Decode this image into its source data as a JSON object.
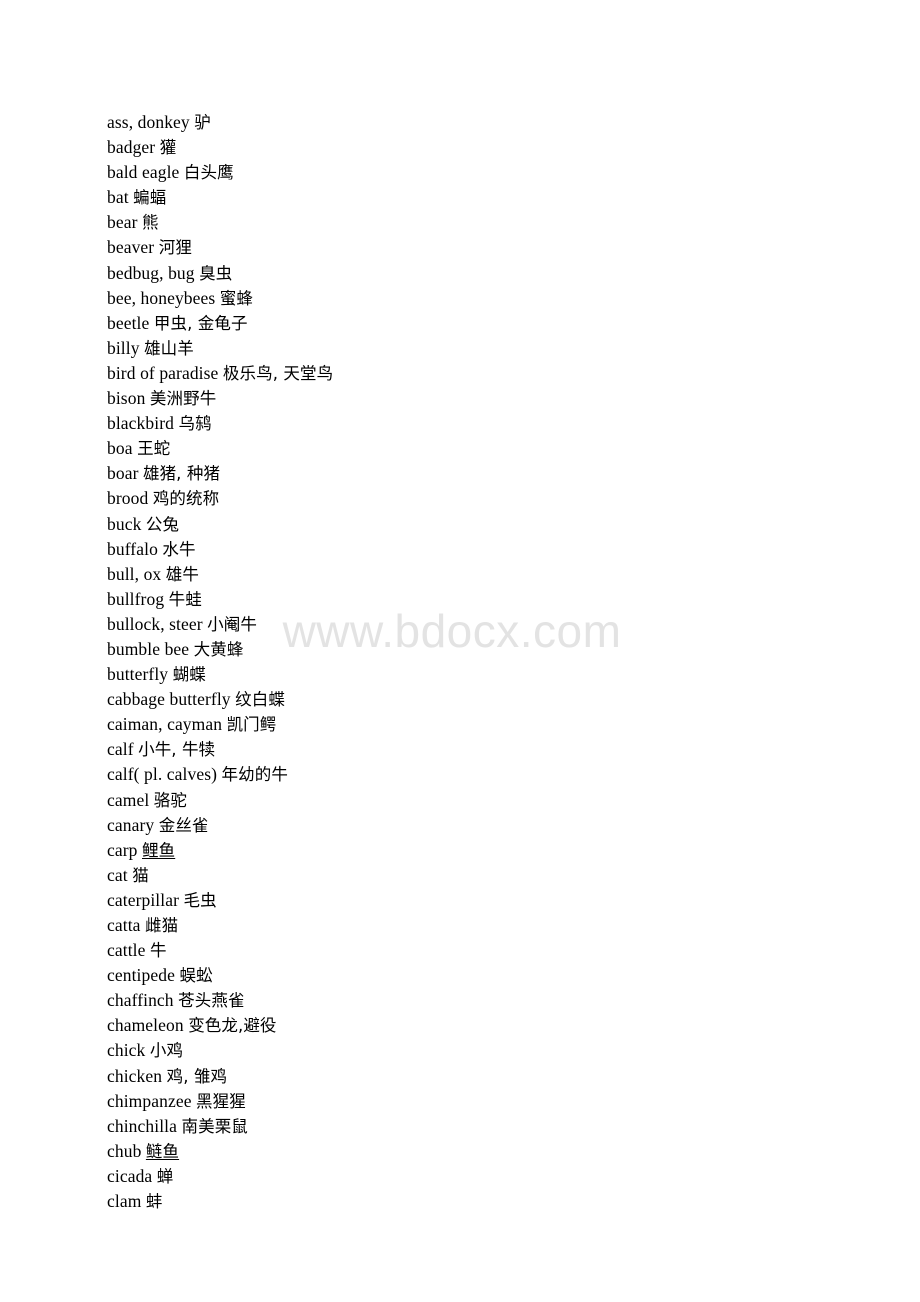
{
  "document": {
    "watermark": "www.bdocx.com",
    "watermark_color": "#e3e3e3",
    "text_color": "#000000",
    "background_color": "#ffffff"
  },
  "entries": [
    {
      "term": "ass, donkey",
      "gloss": "驴",
      "underlined": false
    },
    {
      "term": "badger",
      "gloss": "獾",
      "underlined": false
    },
    {
      "term": "bald eagle",
      "gloss": "白头鹰",
      "underlined": false
    },
    {
      "term": "bat",
      "gloss": "蝙蝠",
      "underlined": false
    },
    {
      "term": "bear",
      "gloss": "熊",
      "underlined": false
    },
    {
      "term": "beaver",
      "gloss": "河狸",
      "underlined": false
    },
    {
      "term": "bedbug, bug",
      "gloss": "臭虫",
      "underlined": false
    },
    {
      "term": "bee, honeybees",
      "gloss": "蜜蜂",
      "underlined": false
    },
    {
      "term": "beetle",
      "gloss": "甲虫, 金龟子",
      "underlined": false
    },
    {
      "term": "billy",
      "gloss": "雄山羊",
      "underlined": false
    },
    {
      "term": "bird of paradise",
      "gloss": "极乐鸟, 天堂鸟",
      "underlined": false
    },
    {
      "term": "bison",
      "gloss": "美洲野牛",
      "underlined": false
    },
    {
      "term": "blackbird",
      "gloss": "乌鸫",
      "underlined": false
    },
    {
      "term": "boa",
      "gloss": "王蛇",
      "underlined": false
    },
    {
      "term": "boar",
      "gloss": "雄猪, 种猪",
      "underlined": false
    },
    {
      "term": "brood",
      "gloss": "鸡的统称",
      "underlined": false
    },
    {
      "term": "buck",
      "gloss": "公兔",
      "underlined": false
    },
    {
      "term": "buffalo",
      "gloss": "水牛",
      "underlined": false
    },
    {
      "term": "bull, ox",
      "gloss": "雄牛",
      "underlined": false
    },
    {
      "term": "bullfrog",
      "gloss": "牛蛙",
      "underlined": false
    },
    {
      "term": "bullock, steer",
      "gloss": "小阉牛",
      "underlined": false
    },
    {
      "term": "bumble bee",
      "gloss": "大黄蜂",
      "underlined": false
    },
    {
      "term": "butterfly",
      "gloss": "蝴蝶",
      "underlined": false
    },
    {
      "term": "cabbage butterfly",
      "gloss": "纹白蝶",
      "underlined": false
    },
    {
      "term": "caiman, cayman",
      "gloss": "凯门鳄",
      "underlined": false
    },
    {
      "term": "calf",
      "gloss": "小牛, 牛犊",
      "underlined": false
    },
    {
      "term": "calf( pl. calves)",
      "gloss": "年幼的牛",
      "underlined": false
    },
    {
      "term": "camel",
      "gloss": "骆驼",
      "underlined": false
    },
    {
      "term": "canary",
      "gloss": "金丝雀",
      "underlined": false
    },
    {
      "term": "carp",
      "gloss": "鲤鱼",
      "underlined": true
    },
    {
      "term": "cat",
      "gloss": "猫",
      "underlined": false
    },
    {
      "term": "caterpillar",
      "gloss": "毛虫",
      "underlined": false
    },
    {
      "term": "catta",
      "gloss": "雌猫",
      "underlined": false
    },
    {
      "term": "cattle",
      "gloss": "牛",
      "underlined": false
    },
    {
      "term": "centipede",
      "gloss": "蜈蚣",
      "underlined": false
    },
    {
      "term": "chaffinch",
      "gloss": "苍头燕雀",
      "underlined": false
    },
    {
      "term": "chameleon",
      "gloss": "变色龙,避役",
      "underlined": false
    },
    {
      "term": "chick",
      "gloss": "小鸡",
      "underlined": false
    },
    {
      "term": "chicken",
      "gloss": "鸡, 雏鸡",
      "underlined": false
    },
    {
      "term": "chimpanzee",
      "gloss": "黑猩猩",
      "underlined": false
    },
    {
      "term": "chinchilla",
      "gloss": "南美栗鼠",
      "underlined": false
    },
    {
      "term": "chub",
      "gloss": "鲢鱼",
      "underlined": true
    },
    {
      "term": "cicada",
      "gloss": "蝉",
      "underlined": false
    },
    {
      "term": "clam",
      "gloss": "蚌",
      "underlined": false
    }
  ]
}
